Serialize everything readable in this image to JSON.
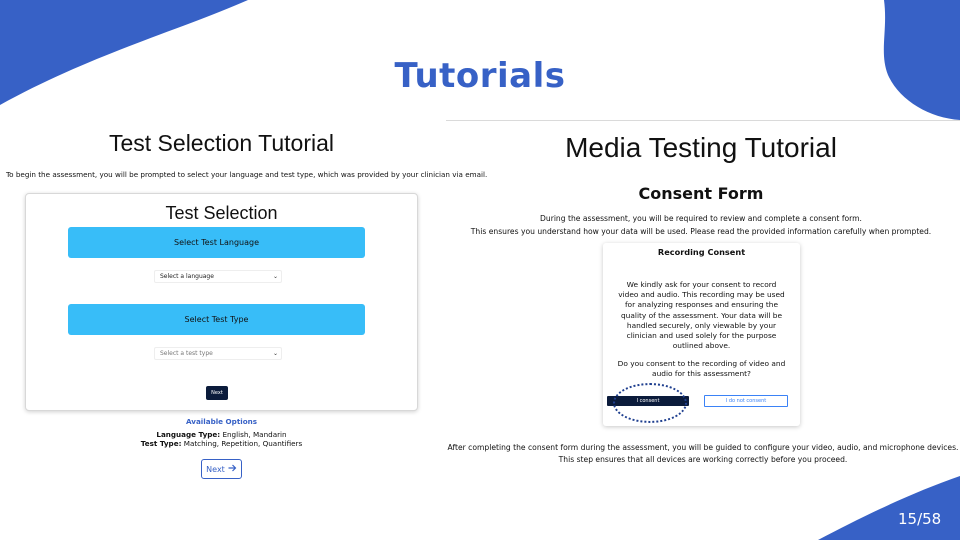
{
  "slide": {
    "title": "Tutorials",
    "page_number": "15/58",
    "colors": {
      "accent": "#3761c6",
      "button_blue": "#38bdf8",
      "dark_navy": "#0b1b3b"
    }
  },
  "left": {
    "heading": "Test Selection Tutorial",
    "intro": "To begin the assessment, you will be prompted to select your language and test type, which was provided by your clinician via email.",
    "card": {
      "title": "Test Selection",
      "language_button": "Select Test Language",
      "language_select_placeholder": "Select a language",
      "type_button": "Select Test Type",
      "type_select_placeholder": "Select a test type",
      "next_label": "Next"
    },
    "available": {
      "title": "Available Options",
      "language_label": "Language Type:",
      "language_value": " English, Mandarin",
      "test_label": "Test Type:",
      "test_value": " Matching, Repetition, Quantifiers"
    },
    "next_button": "Next",
    "next_icon": "arrow-right-icon"
  },
  "right": {
    "heading": "Media Testing Tutorial",
    "consent_heading": "Consent Form",
    "intro_line1": "During the assessment, you will be required to review and complete a consent form.",
    "intro_line2": "This ensures you understand how your data will be used. Please read the provided information carefully when prompted.",
    "recording_card": {
      "title": "Recording Consent",
      "body": "We kindly ask for your consent to record video and audio. This recording may be used for analyzing responses and ensuring the quality of the assessment. Your data will be handled securely, only viewable by your clinician and used solely for the purpose outlined above.",
      "question": "Do you consent to the recording of video and audio for this assessment?",
      "consent_button": "I consent",
      "no_consent_button": "I do not consent"
    },
    "after_line1": "After completing the consent form during the assessment, you will be guided to configure your video, audio, and microphone devices.",
    "after_line2": "This step ensures that all devices are working correctly before you proceed."
  }
}
